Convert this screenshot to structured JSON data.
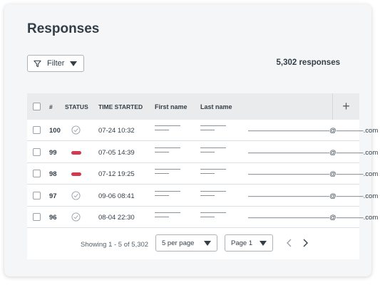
{
  "page": {
    "title": "Responses"
  },
  "toolbar": {
    "filter_label": "Filter",
    "response_count": "5,302 responses"
  },
  "table": {
    "headers": {
      "number": "#",
      "status": "STATUS",
      "time_started": "TIME STARTED",
      "first_name": "First name",
      "last_name": "Last name",
      "add": "+"
    },
    "rows": [
      {
        "number": "100",
        "status": "complete",
        "time": "07-24 10:32",
        "email": "————————————@————.com"
      },
      {
        "number": "99",
        "status": "incomplete",
        "time": "07-05 14:39",
        "email": "————————————@————.com"
      },
      {
        "number": "98",
        "status": "incomplete",
        "time": "07-12 19:25",
        "email": "————————————@————.com"
      },
      {
        "number": "97",
        "status": "complete",
        "time": "09-06 08:41",
        "email": "————————————@————.com"
      },
      {
        "number": "96",
        "status": "complete",
        "time": "08-04 22:30",
        "email": "————————————@————.com"
      }
    ]
  },
  "footer": {
    "showing": "Showing 1 - 5 of 5,302",
    "per_page": "5 per page",
    "page": "Page 1"
  },
  "colors": {
    "incomplete": "#d23a4f",
    "complete_icon": "#9aa1a8"
  },
  "icons": {
    "filter": "funnel-icon",
    "caret": "caret-down-icon",
    "complete": "check-circle-icon",
    "prev": "chevron-left-icon",
    "next": "chevron-right-icon"
  }
}
